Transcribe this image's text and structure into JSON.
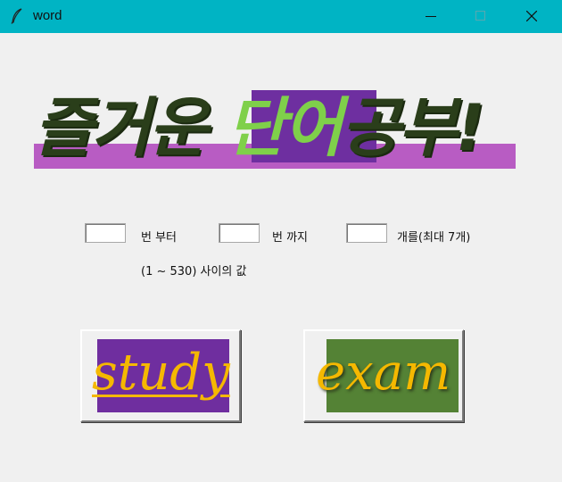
{
  "window": {
    "title": "word",
    "icons": {
      "app": "feather-icon",
      "minimize": "minimize-icon",
      "maximize": "maximize-icon",
      "close": "close-icon"
    }
  },
  "banner": {
    "part1": "즐거운 ",
    "highlight": "단어",
    "part2": "공부!",
    "colors": {
      "text": "#2a3e1a",
      "highlight_bg": "#6e2fa0",
      "highlight_text": "#7fd04a",
      "stripe": "#b85cc3"
    }
  },
  "form": {
    "from_value": "",
    "from_label": "번 부터",
    "to_value": "",
    "to_label": "번 까지",
    "count_value": "",
    "count_label": "개를(최대 7개)",
    "hint": "(1 ~ 530) 사이의 값"
  },
  "buttons": {
    "study_label": "study",
    "exam_label": "exam",
    "colors": {
      "study_bg": "#6f2e9f",
      "exam_bg": "#548235",
      "text": "#f5b800"
    }
  }
}
